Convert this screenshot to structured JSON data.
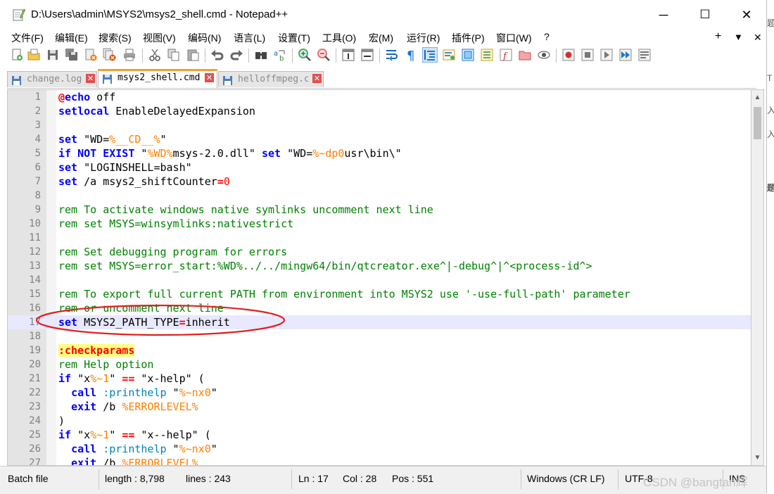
{
  "window": {
    "title": "D:\\Users\\admin\\MSYS2\\msys2_shell.cmd - Notepad++"
  },
  "controls": {
    "minimize": "─",
    "maximize": "☐",
    "close": "✕",
    "menu_plus": "+",
    "menu_down": "▼",
    "menu_close": "✕"
  },
  "menu": [
    "文件(F)",
    "编辑(E)",
    "搜索(S)",
    "视图(V)",
    "编码(N)",
    "语言(L)",
    "设置(T)",
    "工具(O)",
    "宏(M)",
    "运行(R)",
    "插件(P)",
    "窗口(W)",
    "?"
  ],
  "tabs": [
    {
      "label": "change.log",
      "active": false
    },
    {
      "label": "msys2_shell.cmd",
      "active": true
    },
    {
      "label": "helloffmpeg.c",
      "active": false
    }
  ],
  "editor": {
    "current_line": 17,
    "lines": [
      {
        "n": "1",
        "parts": [
          [
            "op",
            "@"
          ],
          [
            "kw",
            "echo"
          ],
          [
            "pl",
            " off"
          ]
        ]
      },
      {
        "n": "2",
        "parts": [
          [
            "kw",
            "setlocal"
          ],
          [
            "pl",
            " EnableDelayedExpansion"
          ]
        ]
      },
      {
        "n": "3",
        "parts": []
      },
      {
        "n": "4",
        "parts": [
          [
            "kw",
            "set"
          ],
          [
            "pl",
            " \"WD="
          ],
          [
            "vr",
            "%__CD__%"
          ],
          [
            "pl",
            "\""
          ]
        ]
      },
      {
        "n": "5",
        "parts": [
          [
            "kw",
            "if NOT EXIST"
          ],
          [
            "pl",
            " \""
          ],
          [
            "vr",
            "%WD%"
          ],
          [
            "pl",
            "msys-2.0.dll\" "
          ],
          [
            "kw",
            "set"
          ],
          [
            "pl",
            " \"WD="
          ],
          [
            "vr",
            "%~dp0"
          ],
          [
            "pl",
            "usr\\bin\\\""
          ]
        ]
      },
      {
        "n": "6",
        "parts": [
          [
            "kw",
            "set"
          ],
          [
            "pl",
            " \"LOGINSHELL=bash\""
          ]
        ]
      },
      {
        "n": "7",
        "parts": [
          [
            "kw",
            "set"
          ],
          [
            "pl",
            " /a msys2_shiftCounter"
          ],
          [
            "op",
            "="
          ],
          [
            "nm",
            "0"
          ]
        ]
      },
      {
        "n": "8",
        "parts": []
      },
      {
        "n": "9",
        "parts": [
          [
            "cm",
            "rem To activate windows native symlinks uncomment next line"
          ]
        ]
      },
      {
        "n": "10",
        "parts": [
          [
            "cm",
            "rem set MSYS=winsymlinks:nativestrict"
          ]
        ]
      },
      {
        "n": "11",
        "parts": []
      },
      {
        "n": "12",
        "parts": [
          [
            "cm",
            "rem Set debugging program for errors"
          ]
        ]
      },
      {
        "n": "13",
        "parts": [
          [
            "cm",
            "rem set MSYS=error_start:%WD%../../mingw64/bin/qtcreator.exe^|-debug^|^<process-id^>"
          ]
        ]
      },
      {
        "n": "14",
        "parts": []
      },
      {
        "n": "15",
        "parts": [
          [
            "cm",
            "rem To export full current PATH from environment into MSYS2 use '-use-full-path' parameter"
          ]
        ]
      },
      {
        "n": "16",
        "parts": [
          [
            "cm",
            "rem or uncomment next line"
          ]
        ]
      },
      {
        "n": "17",
        "parts": [
          [
            "kw",
            "set"
          ],
          [
            "pl",
            " MSYS2_PATH_TYPE"
          ],
          [
            "op",
            "="
          ],
          [
            "pl",
            "inherit"
          ]
        ]
      },
      {
        "n": "18",
        "parts": []
      },
      {
        "n": "19",
        "parts": [
          [
            "lb",
            ":checkparams"
          ]
        ]
      },
      {
        "n": "20",
        "parts": [
          [
            "cm",
            "rem Help option"
          ]
        ]
      },
      {
        "n": "21",
        "parts": [
          [
            "kw",
            "if"
          ],
          [
            "pl",
            " \"x"
          ],
          [
            "vr",
            "%~1"
          ],
          [
            "pl",
            "\" "
          ],
          [
            "op",
            "=="
          ],
          [
            "pl",
            " \"x-help\" ("
          ]
        ]
      },
      {
        "n": "22",
        "parts": [
          [
            "pl",
            "  "
          ],
          [
            "kw",
            "call"
          ],
          [
            "pl",
            " "
          ],
          [
            "ps",
            ":printhelp"
          ],
          [
            "pl",
            " \""
          ],
          [
            "vr",
            "%~nx0"
          ],
          [
            "pl",
            "\""
          ]
        ]
      },
      {
        "n": "23",
        "parts": [
          [
            "pl",
            "  "
          ],
          [
            "kw",
            "exit"
          ],
          [
            "pl",
            " /b "
          ],
          [
            "vr",
            "%ERRORLEVEL%"
          ]
        ]
      },
      {
        "n": "24",
        "parts": [
          [
            "pl",
            ")"
          ]
        ]
      },
      {
        "n": "25",
        "parts": [
          [
            "kw",
            "if"
          ],
          [
            "pl",
            " \"x"
          ],
          [
            "vr",
            "%~1"
          ],
          [
            "pl",
            "\" "
          ],
          [
            "op",
            "=="
          ],
          [
            "pl",
            " \"x--help\" ("
          ]
        ]
      },
      {
        "n": "26",
        "parts": [
          [
            "pl",
            "  "
          ],
          [
            "kw",
            "call"
          ],
          [
            "pl",
            " "
          ],
          [
            "ps",
            ":printhelp"
          ],
          [
            "pl",
            " \""
          ],
          [
            "vr",
            "%~nx0"
          ],
          [
            "pl",
            "\""
          ]
        ]
      },
      {
        "n": "27",
        "parts": [
          [
            "pl",
            "  "
          ],
          [
            "kw",
            "exit"
          ],
          [
            "pl",
            " /b "
          ],
          [
            "vr",
            "%ERRORLEVEL%"
          ]
        ]
      }
    ]
  },
  "status": {
    "filetype": "Batch file",
    "length": "length : 8,798",
    "lines": "lines : 243",
    "ln": "Ln : 17",
    "col": "Col : 28",
    "pos": "Pos : 551",
    "eol": "Windows (CR LF)",
    "encoding": "UTF-8",
    "mode": "INS"
  },
  "watermark": "CSDN @bangtan辉",
  "colors": {
    "keyword": "#0000ff",
    "comment": "#008000",
    "variable": "#ff8000",
    "operator": "#ff0000",
    "annotation": "#e02020"
  }
}
